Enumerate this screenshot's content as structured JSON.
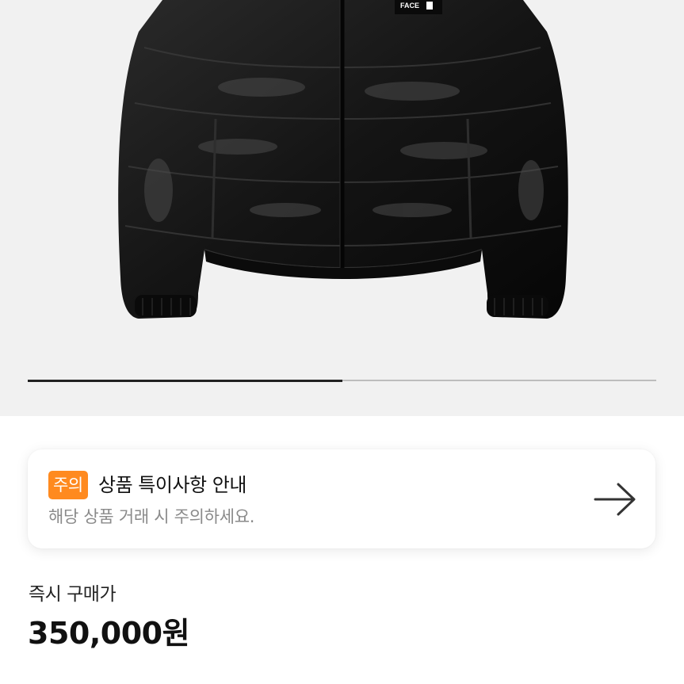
{
  "product_image": {
    "brand_logo_text": "FACE",
    "gallery_progress": 0.5,
    "progress_fill_color": "#222222",
    "progress_track_color": "#bdbdbd",
    "background_color": "#f1f1f1"
  },
  "notice": {
    "badge": "주의",
    "badge_color": "#ff8a1f",
    "title": "상품 특이사항 안내",
    "subtitle": "해당 상품 거래 시 주의하세요.",
    "arrow_icon": "arrow-right-icon"
  },
  "price": {
    "label": "즉시 구매가",
    "value": "350,000원"
  }
}
